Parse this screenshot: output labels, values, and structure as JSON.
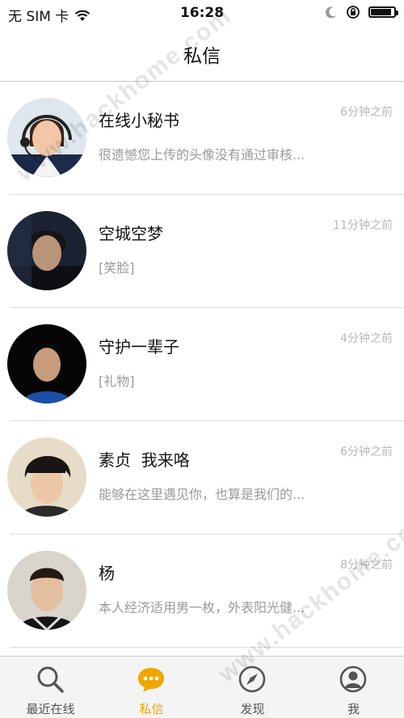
{
  "status_bar": {
    "carrier": "无 SIM 卡",
    "time": "16:28",
    "battery_level": 0.9
  },
  "nav": {
    "title": "私信"
  },
  "messages": [
    {
      "name": "在线小秘书",
      "time": "6分钟之前",
      "preview": "很遗憾您上传的头像没有通过审核..."
    },
    {
      "name": "空城空梦",
      "time": "11分钟之前",
      "preview": "[笑脸]"
    },
    {
      "name": "守护一辈子",
      "time": "4分钟之前",
      "preview": "[礼物]"
    },
    {
      "name": "素贞  我来咯",
      "time": "6分钟之前",
      "preview": "能够在这里遇见你，也算是我们的..."
    },
    {
      "name": "杨",
      "time": "8分钟之前",
      "preview": "本人经济适用男一枚，外表阳光健..."
    }
  ],
  "tabs": [
    {
      "label": "最近在线",
      "icon": "search-icon",
      "active": false
    },
    {
      "label": "私信",
      "icon": "chat-bubble-icon",
      "active": true
    },
    {
      "label": "发现",
      "icon": "compass-icon",
      "active": false
    },
    {
      "label": "我",
      "icon": "person-icon",
      "active": false
    }
  ],
  "colors": {
    "accent": "#f0a500",
    "inactive_icon": "#555555"
  },
  "watermark": "www.hackhome.com"
}
